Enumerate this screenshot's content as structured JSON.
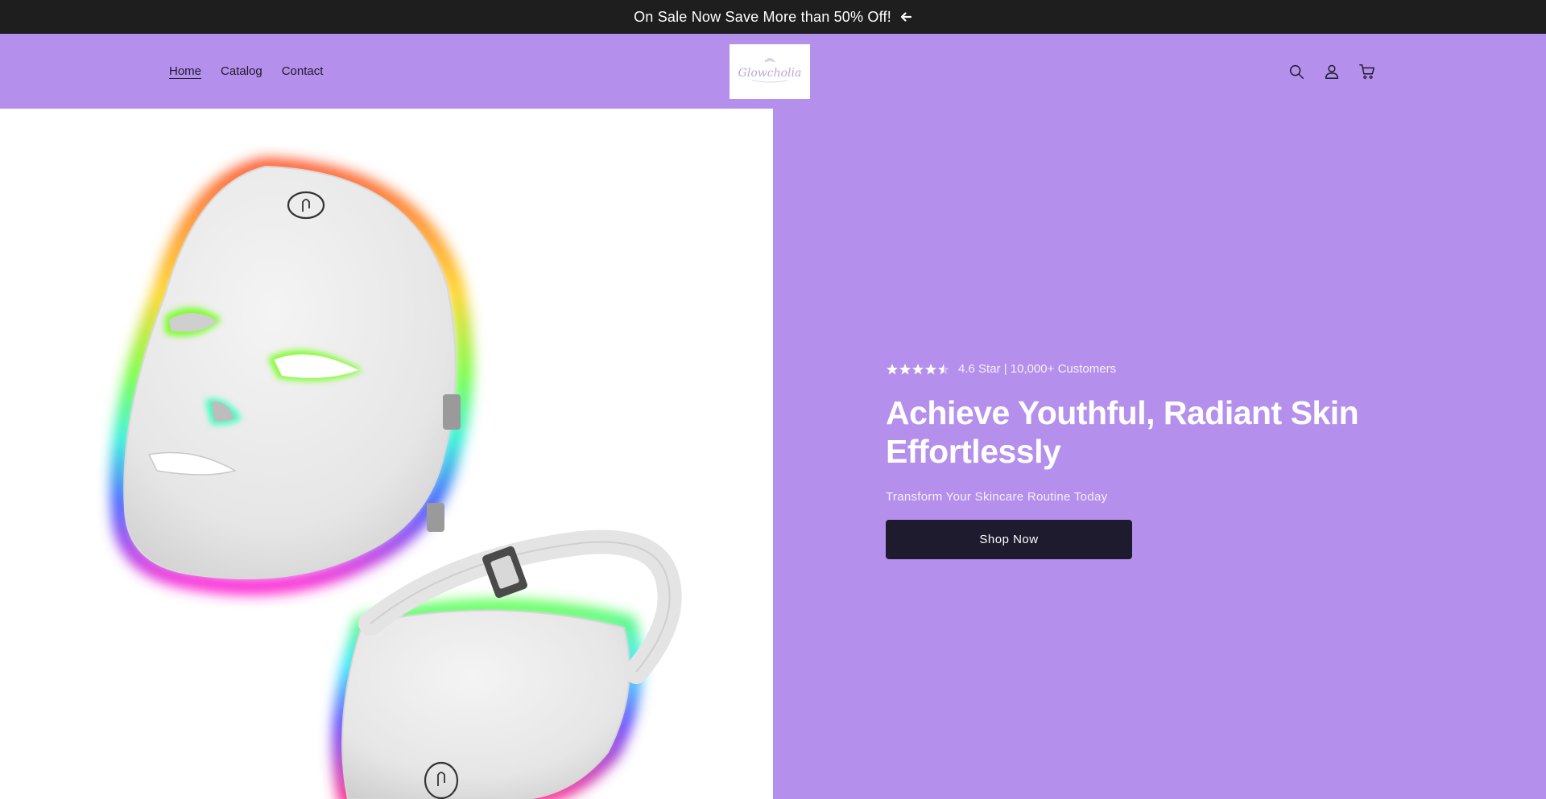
{
  "announcement": {
    "text": "On Sale Now Save More than 50% Off!",
    "icon": "arrow-left-icon"
  },
  "header": {
    "nav": [
      {
        "label": "Home",
        "active": true
      },
      {
        "label": "Catalog",
        "active": false
      },
      {
        "label": "Contact",
        "active": false
      }
    ],
    "logo_text": "Glowcholia",
    "icons": [
      "search-icon",
      "account-icon",
      "cart-icon"
    ]
  },
  "hero": {
    "image_subject": "LED face mask product image",
    "rating": {
      "stars": 4.5,
      "text": "4.6 Star | 10,000+ Customers"
    },
    "headline": "Achieve Youthful, Radiant Skin Effortlessly",
    "subheadline": "Transform Your Skincare Routine Today",
    "cta_label": "Shop Now"
  },
  "colors": {
    "brand": "#b58fec",
    "announcement_bg": "#1e1e1e",
    "button_bg": "#1e1b2e",
    "text_light": "#ffffff"
  }
}
